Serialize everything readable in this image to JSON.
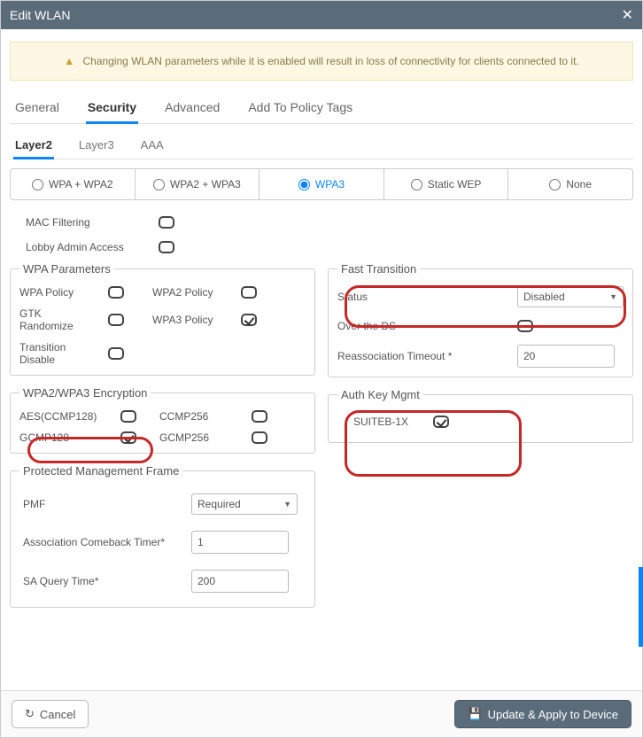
{
  "title": "Edit WLAN",
  "warning": "Changing WLAN parameters while it is enabled will result in loss of connectivity for clients connected to it.",
  "tabs": {
    "general": "General",
    "security": "Security",
    "advanced": "Advanced",
    "policy": "Add To Policy Tags"
  },
  "subtabs": {
    "layer2": "Layer2",
    "layer3": "Layer3",
    "aaa": "AAA"
  },
  "radios": {
    "wpawpa2": "WPA + WPA2",
    "wpa2wpa3": "WPA2 + WPA3",
    "wpa3": "WPA3",
    "staticwep": "Static WEP",
    "none": "None"
  },
  "filters": {
    "mac": "MAC Filtering",
    "lobby": "Lobby Admin Access"
  },
  "wpa": {
    "legend": "WPA Parameters",
    "wpa_policy": "WPA Policy",
    "wpa2_policy": "WPA2 Policy",
    "gtk": "GTK Randomize",
    "wpa3_policy": "WPA3 Policy",
    "trans": "Transition Disable"
  },
  "enc": {
    "legend": "WPA2/WPA3 Encryption",
    "aes": "AES(CCMP128)",
    "ccmp256": "CCMP256",
    "gcmp128": "GCMP128",
    "gcmp256": "GCMP256"
  },
  "ft": {
    "legend": "Fast Transition",
    "status": "Status",
    "status_val": "Disabled",
    "overds": "Over the DS",
    "reassoc": "Reassociation Timeout *",
    "reassoc_val": "20"
  },
  "auth": {
    "legend": "Auth Key Mgmt",
    "suiteb": "SUITEB-1X"
  },
  "pmf": {
    "legend": "Protected Management Frame",
    "pmf": "PMF",
    "pmf_val": "Required",
    "assoc": "Association Comeback Timer*",
    "assoc_val": "1",
    "saq": "SA Query Time*",
    "saq_val": "200"
  },
  "footer": {
    "cancel": "Cancel",
    "apply": "Update & Apply to Device"
  }
}
